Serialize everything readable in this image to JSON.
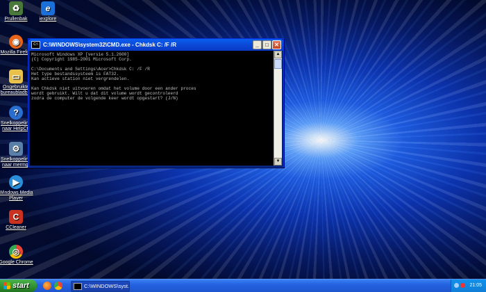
{
  "desktop": {
    "icons": [
      {
        "label": "Prullenbak",
        "color": "#4a7a3a",
        "glyph": "♻"
      },
      {
        "label": "iexplore",
        "color": "#1b6fd8",
        "glyph": "e"
      },
      {
        "label": "Mozilla Firefox",
        "color": "#e8641b",
        "glyph": "◉"
      },
      {
        "label": "Ongebruikte bureaubladb...",
        "color": "#e8c24a",
        "glyph": "▭"
      },
      {
        "label": "Snelkoppeling naar HelpCtr",
        "color": "#2a6fd0",
        "glyph": "?"
      },
      {
        "label": "Snelkoppeling naar mermgr",
        "color": "#5a7fa8",
        "glyph": "⚙"
      },
      {
        "label": "Windows Media Player",
        "color": "#2a8fd8",
        "glyph": "▶"
      },
      {
        "label": "CCleaner",
        "color": "#c8321e",
        "glyph": "C"
      },
      {
        "label": "Google Chrome",
        "color": "#34a853",
        "glyph": "◎"
      }
    ]
  },
  "cmd_window": {
    "title": "C:\\WINDOWS\\system32\\CMD.exe - Chkdsk C: /F /R",
    "minimize": "_",
    "maximize": "□",
    "close": "✕",
    "console_text": "Microsoft Windows XP [versie 5.1.2600]\n(C) Copyright 1985-2001 Microsoft Corp.\n\nC:\\Documents and Settings\\Acer>Chkdsk C: /F /R\nHet type bestandssysteem is FAT32.\nKan actieve station niet vergrendelen.\n\nKan Chkdsk niet uitvoeren omdat het volume door een ander proces\nwordt gebruikt. Wilt u dat dit volume wordt gecontroleerd\nzodra de computer de volgende keer wordt opgestart? (J/N)"
  },
  "taskbar": {
    "start_label": "start",
    "task_button_label": "C:\\WINDOWS\\syst...",
    "clock": "21:05"
  }
}
